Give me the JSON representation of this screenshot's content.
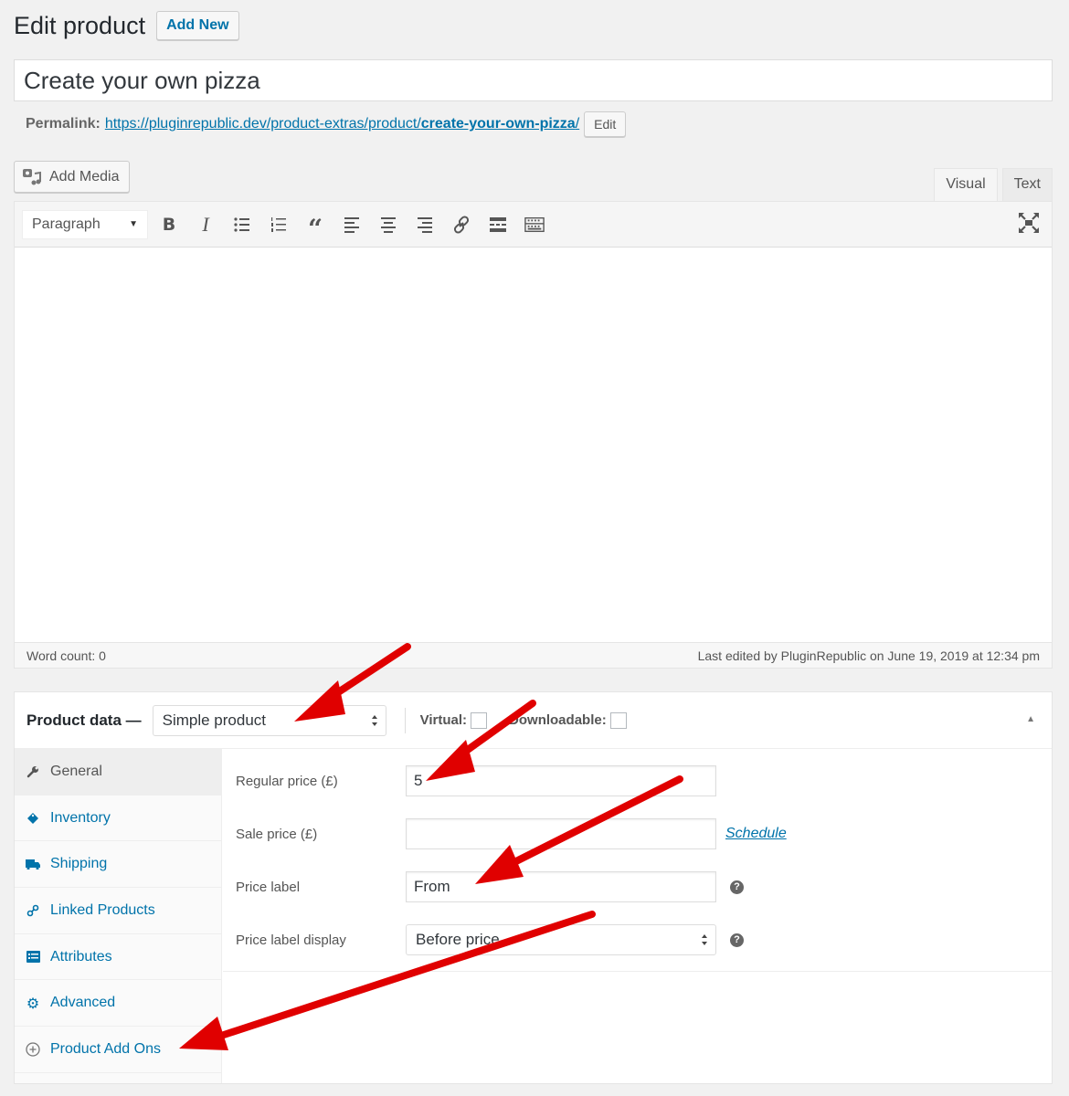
{
  "header": {
    "title": "Edit product",
    "add_new_label": "Add New"
  },
  "post": {
    "title_value": "Create your own pizza",
    "permalink_label": "Permalink:",
    "permalink_base": "https://pluginrepublic.dev/product-extras/product/",
    "permalink_slug": "create-your-own-pizza",
    "permalink_trailing": "/",
    "permalink_edit_label": "Edit"
  },
  "editor": {
    "add_media_label": "Add Media",
    "tabs": [
      {
        "label": "Visual",
        "active": true
      },
      {
        "label": "Text",
        "active": false
      }
    ],
    "format_value": "Paragraph",
    "toolbar_icons": [
      "bold-icon",
      "italic-icon",
      "bulleted-list-icon",
      "numbered-list-icon",
      "blockquote-icon",
      "align-left-icon",
      "align-center-icon",
      "align-right-icon",
      "link-icon",
      "read-more-icon",
      "toolbar-toggle-icon"
    ],
    "word_count": "Word count: 0",
    "last_edited": "Last edited by PluginRepublic on June 19, 2019 at 12:34 pm"
  },
  "product_data": {
    "title": "Product data —",
    "type_value": "Simple product",
    "virtual_label": "Virtual:",
    "virtual_checked": false,
    "downloadable_label": "Downloadable:",
    "downloadable_checked": false,
    "tabs": [
      {
        "label": "General",
        "icon": "wrench-icon",
        "active": true
      },
      {
        "label": "Inventory",
        "icon": "tag-icon",
        "active": false
      },
      {
        "label": "Shipping",
        "icon": "truck-icon",
        "active": false
      },
      {
        "label": "Linked Products",
        "icon": "link-icon",
        "active": false
      },
      {
        "label": "Attributes",
        "icon": "list-icon",
        "active": false
      },
      {
        "label": "Advanced",
        "icon": "gear-icon",
        "active": false
      },
      {
        "label": "Product Add Ons",
        "icon": "plus-circle-icon",
        "active": false
      }
    ],
    "fields": {
      "regular_price_label": "Regular price (£)",
      "regular_price_value": "5",
      "sale_price_label": "Sale price (£)",
      "sale_price_value": "",
      "schedule_label": "Schedule",
      "price_label_label": "Price label",
      "price_label_value": "From",
      "price_label_display_label": "Price label display",
      "price_label_display_value": "Before price"
    }
  },
  "annotation_color": "#e00000"
}
